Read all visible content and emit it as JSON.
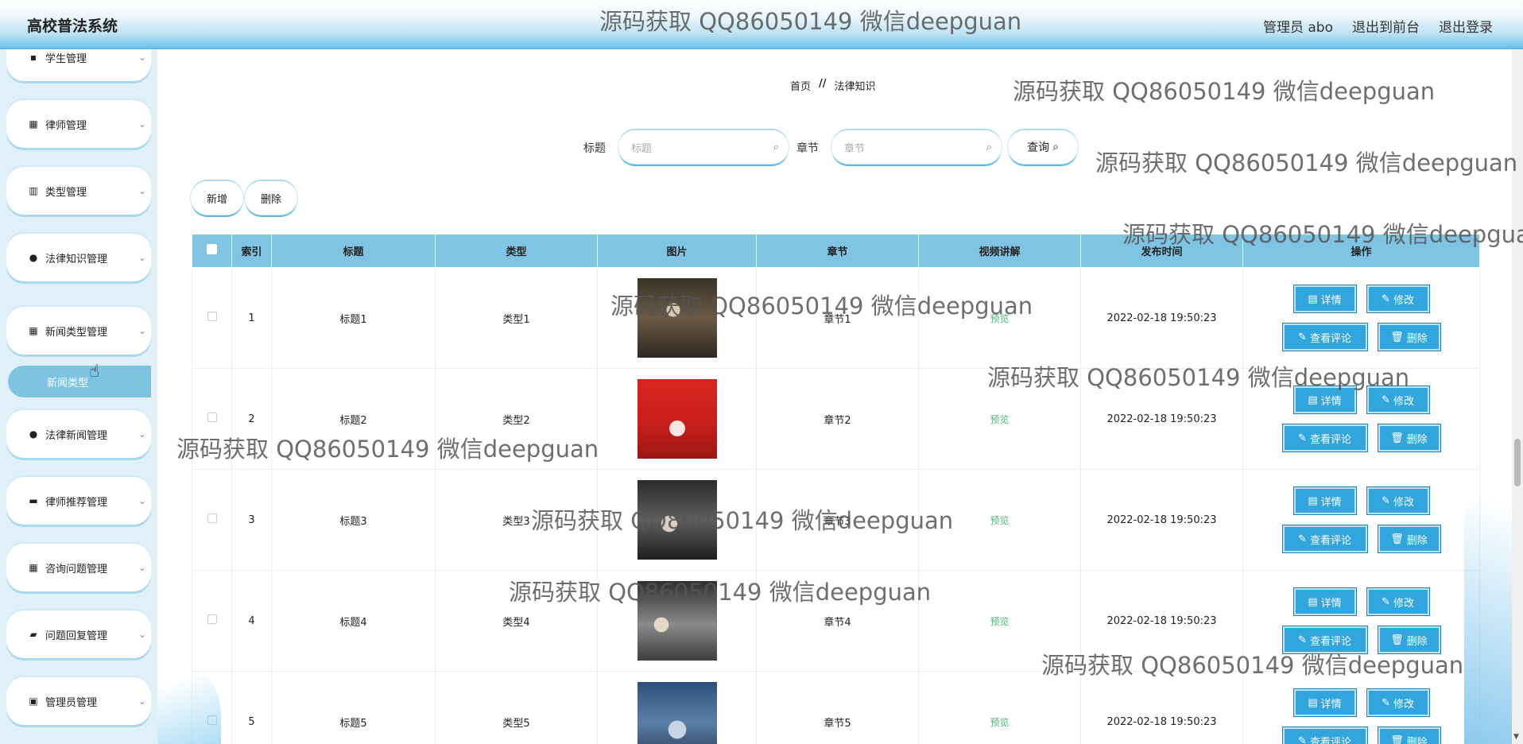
{
  "app": {
    "title": "高校普法系统",
    "user_label": "管理员 abo",
    "back_front": "退出到前台",
    "logout": "退出登录"
  },
  "sidebar": {
    "items": [
      {
        "label": "学生管理",
        "icon": "briefcase-icon"
      },
      {
        "label": "律师管理",
        "icon": "grid-icon"
      },
      {
        "label": "类型管理",
        "icon": "bar-chart-icon"
      },
      {
        "label": "法律知识管理",
        "icon": "user-icon"
      },
      {
        "label": "新闻类型管理",
        "icon": "grid-icon"
      },
      {
        "label": "法律新闻管理",
        "icon": "user-icon"
      },
      {
        "label": "律师推荐管理",
        "icon": "printer-icon"
      },
      {
        "label": "咨询问题管理",
        "icon": "grid-icon"
      },
      {
        "label": "问题回复管理",
        "icon": "thumbs-icon"
      },
      {
        "label": "管理员管理",
        "icon": "clipboard-icon"
      }
    ],
    "active_sub": "新闻类型"
  },
  "breadcrumb": {
    "home": "首页",
    "sep": "//",
    "current": "法律知识"
  },
  "search": {
    "title_label": "标题",
    "title_placeholder": "标题",
    "chapter_label": "章节",
    "chapter_placeholder": "章节",
    "query_label": "查询"
  },
  "actions": {
    "add": "新增",
    "delete": "删除"
  },
  "table": {
    "headers": [
      "索引",
      "标题",
      "类型",
      "图片",
      "章节",
      "视频讲解",
      "发布时间",
      "操作"
    ],
    "preview_label": "预览",
    "op_labels": {
      "detail": "详情",
      "edit": "修改",
      "comments": "查看评论",
      "delete": "删除"
    },
    "rows": [
      {
        "index": "1",
        "title": "标题1",
        "type": "类型1",
        "chapter": "章节1",
        "time": "2022-02-18 19:50:23"
      },
      {
        "index": "2",
        "title": "标题2",
        "type": "类型2",
        "chapter": "章节2",
        "time": "2022-02-18 19:50:23"
      },
      {
        "index": "3",
        "title": "标题3",
        "type": "类型3",
        "chapter": "章节3",
        "time": "2022-02-18 19:50:23"
      },
      {
        "index": "4",
        "title": "标题4",
        "type": "类型4",
        "chapter": "章节4",
        "time": "2022-02-18 19:50:23"
      },
      {
        "index": "5",
        "title": "标题5",
        "type": "类型5",
        "chapter": "章节5",
        "time": "2022-02-18 19:50:23"
      }
    ]
  },
  "watermark": "源码获取 QQ86050149 微信deepguan",
  "colors": {
    "accent": "#31a6de",
    "header_row": "#7fc5e3",
    "sidebar_bg": "#dff0f8",
    "active_sub": "#7ec4e2"
  }
}
